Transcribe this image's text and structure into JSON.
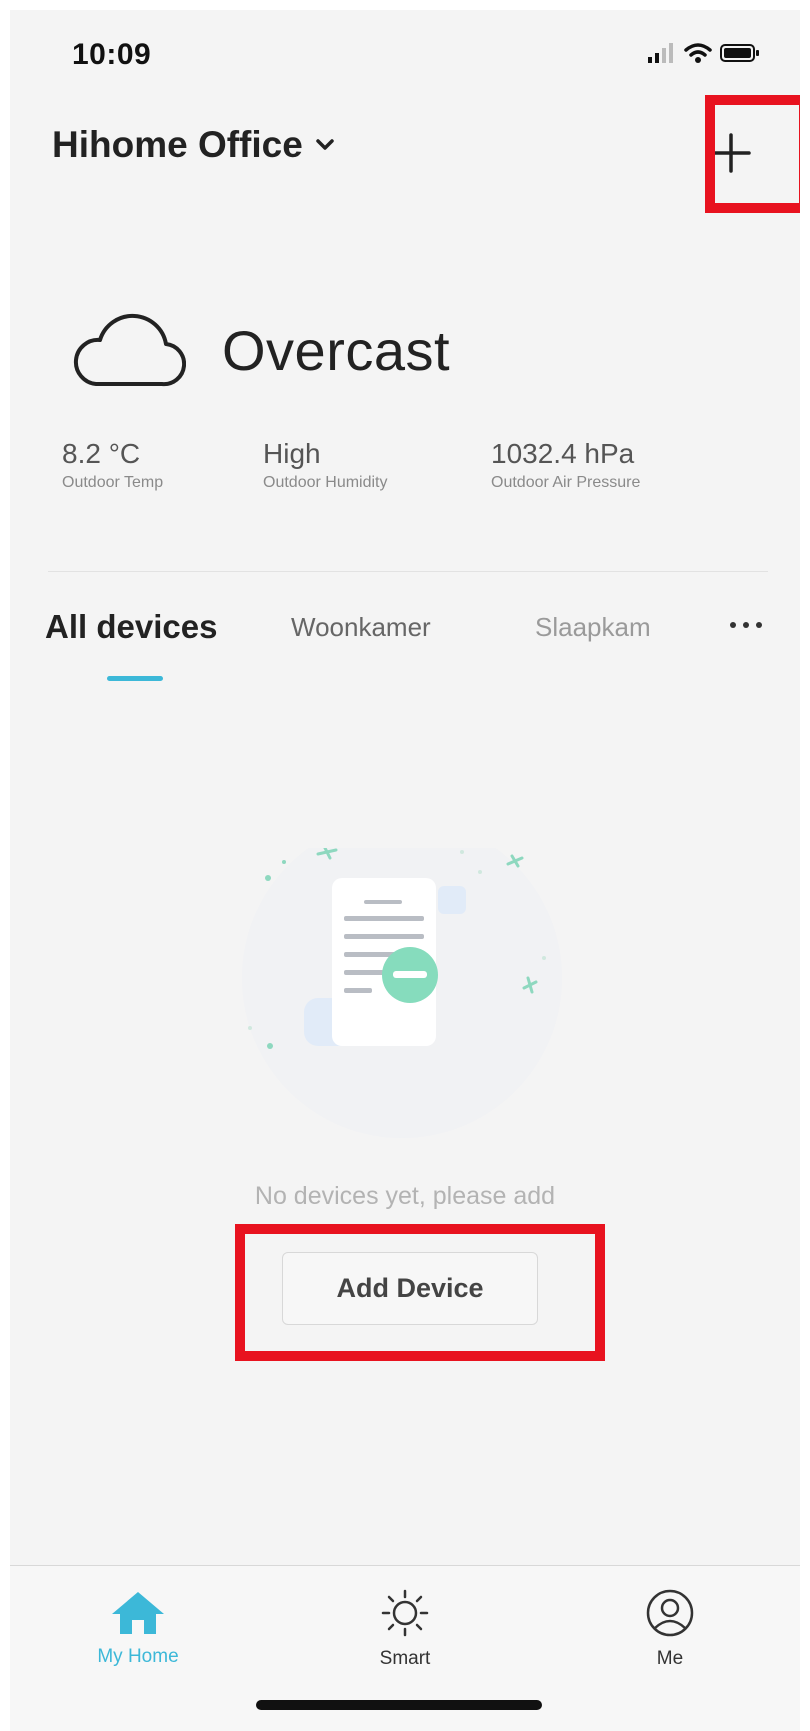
{
  "status_bar": {
    "time": "10:09"
  },
  "header": {
    "home_name": "Hihome Office",
    "add_icon": "plus-icon"
  },
  "weather": {
    "condition": "Overcast",
    "icon": "cloud-icon",
    "metrics": [
      {
        "value": "8.2 °C",
        "label": "Outdoor Temp"
      },
      {
        "value": "High",
        "label": "Outdoor Humidity"
      },
      {
        "value": "1032.4 hPa",
        "label": "Outdoor Air Pressure"
      }
    ]
  },
  "tabs": [
    {
      "label": "All devices",
      "active": true
    },
    {
      "label": "Woonkamer",
      "active": false
    },
    {
      "label": "Slaapkam",
      "active": false
    }
  ],
  "empty_state": {
    "message": "No devices yet, please add",
    "button_label": "Add Device"
  },
  "bottom_nav": [
    {
      "label": "My Home",
      "icon": "home-icon",
      "active": true
    },
    {
      "label": "Smart",
      "icon": "sun-icon",
      "active": false
    },
    {
      "label": "Me",
      "icon": "user-icon",
      "active": false
    }
  ],
  "colors": {
    "accent": "#3cb8d8",
    "highlight": "#e8121f",
    "background": "#f4f4f4"
  }
}
